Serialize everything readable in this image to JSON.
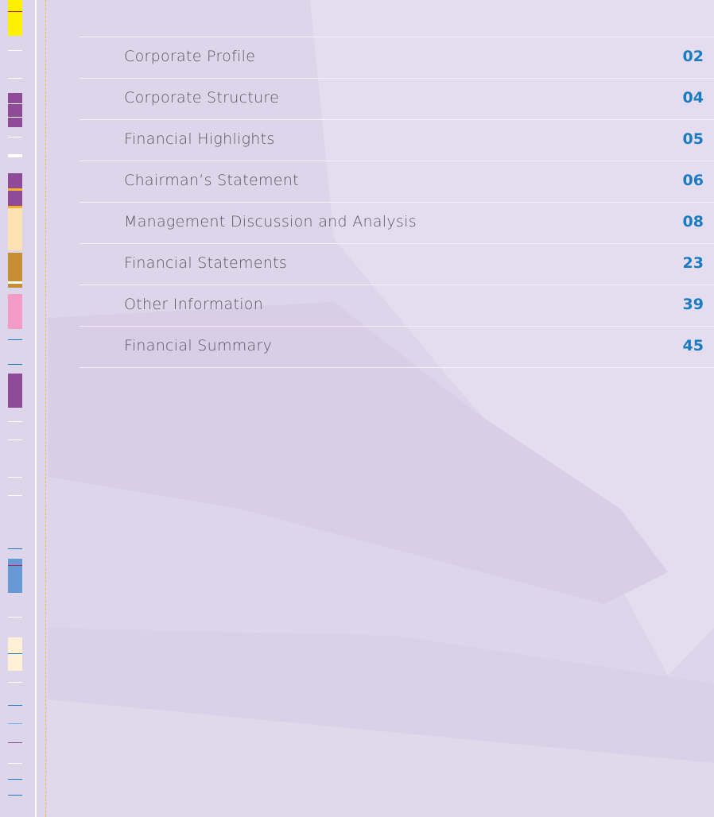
{
  "toc": [
    {
      "title": "Corporate Profile",
      "page": "02"
    },
    {
      "title": "Corporate Structure",
      "page": "04"
    },
    {
      "title": "Financial Highlights",
      "page": "05"
    },
    {
      "title": "Chairman’s Statement",
      "page": "06"
    },
    {
      "title": "Management Discussion and Analysis",
      "page": "08"
    },
    {
      "title": "Financial Statements",
      "page": "23"
    },
    {
      "title": "Other Information",
      "page": "39"
    },
    {
      "title": "Financial Summary",
      "page": "45"
    }
  ],
  "colors": {
    "background": "#ddd5ea",
    "title_text": "#5a5563",
    "page_number": "#1a7bc1",
    "dashed_rule": "#f3bd4f",
    "divider": "#f4f0f8"
  }
}
